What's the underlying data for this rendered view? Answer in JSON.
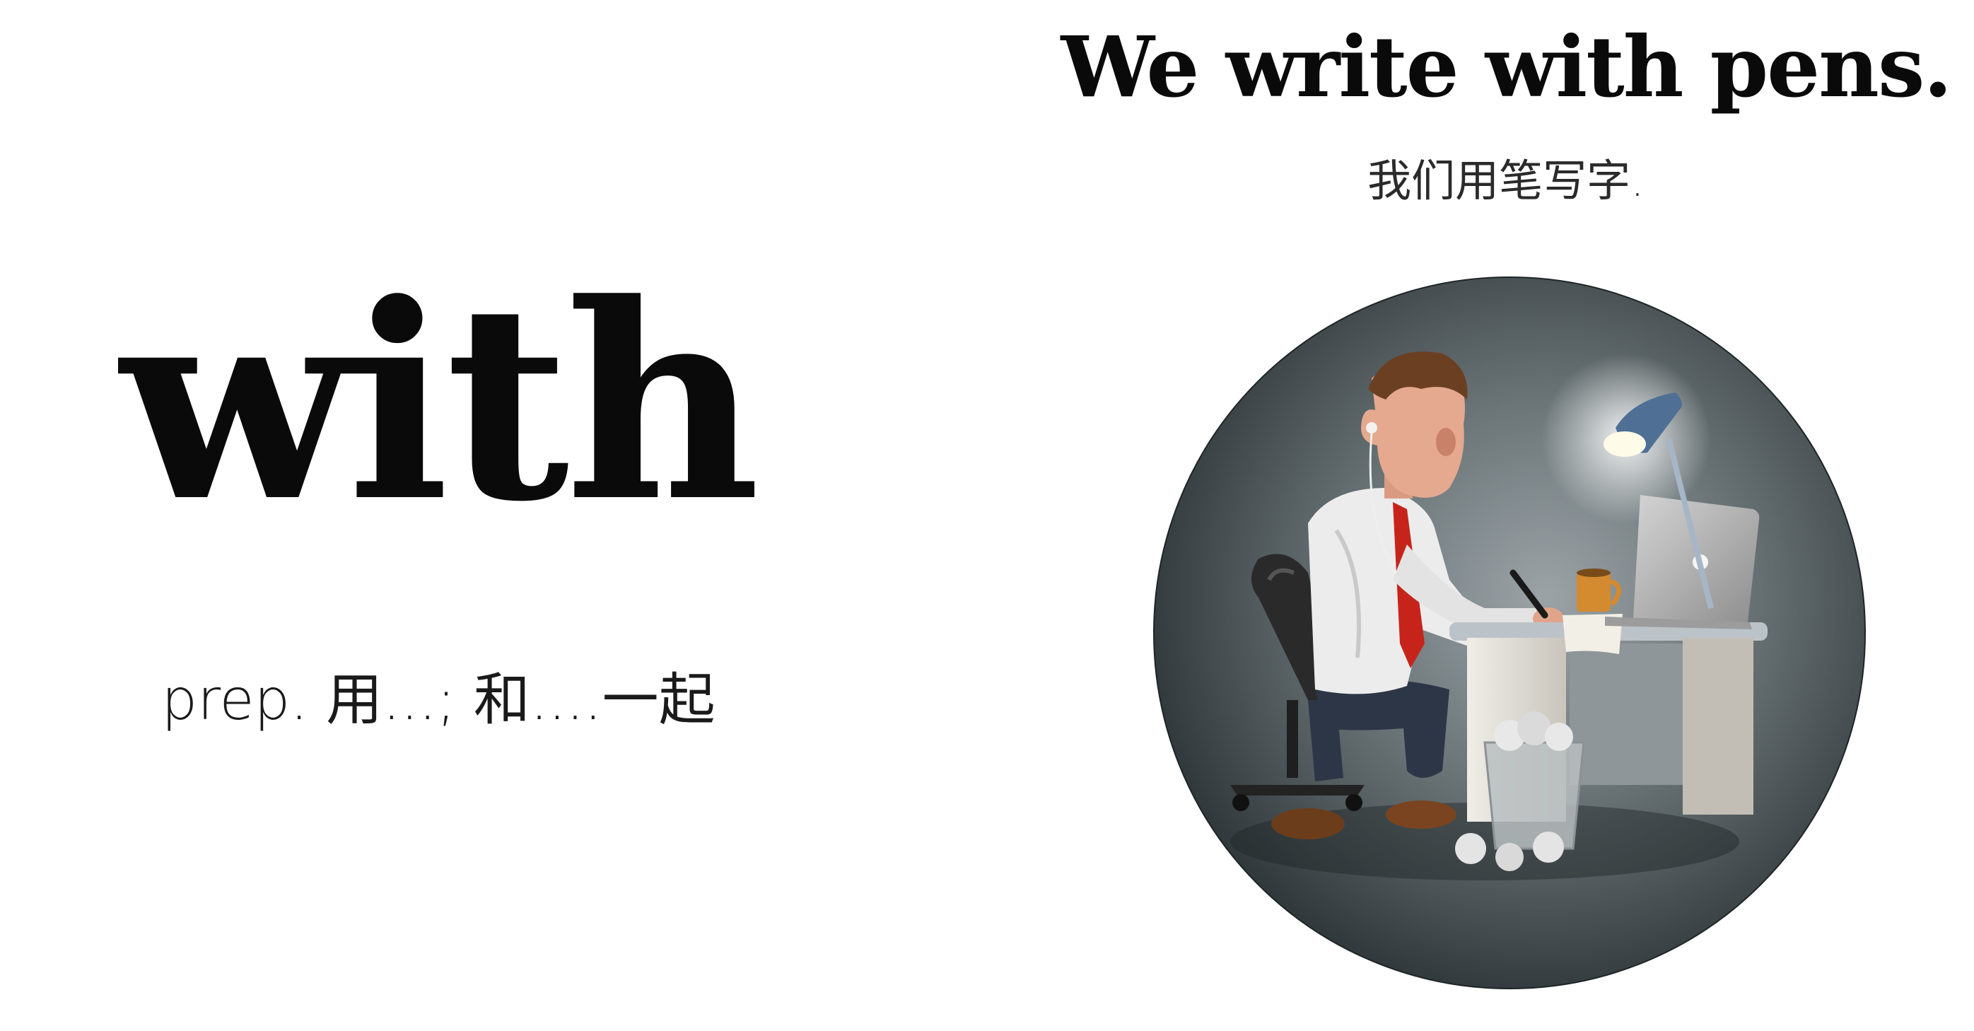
{
  "vocab": {
    "word": "with",
    "definition": "prep. 用...; 和....一起"
  },
  "example": {
    "sentence": "We write with pens.",
    "translation": "我们用笔写字."
  },
  "colors": {
    "background": "#ffffff",
    "text": "#0a0a0a",
    "circle_center": "#8f989c",
    "circle_edge": "#2b3235",
    "lamp": "#4f6f95",
    "laptop": "#b8b8b8",
    "desk": "#e5e2dc",
    "shirt": "#ececec",
    "tie": "#c6241b"
  }
}
